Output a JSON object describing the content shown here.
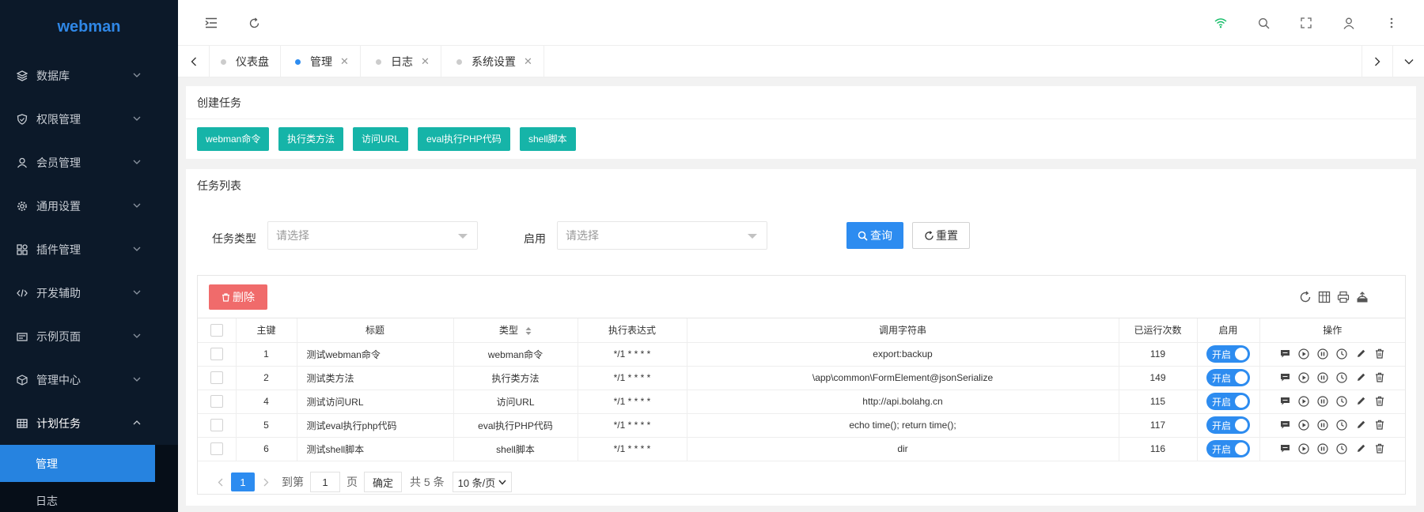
{
  "app": {
    "logo": "webman"
  },
  "sidebar": {
    "items": [
      {
        "label": "数据库",
        "icon": "database-icon"
      },
      {
        "label": "权限管理",
        "icon": "shield-icon"
      },
      {
        "label": "会员管理",
        "icon": "user-icon"
      },
      {
        "label": "通用设置",
        "icon": "gear-icon"
      },
      {
        "label": "插件管理",
        "icon": "plugin-icon"
      },
      {
        "label": "开发辅助",
        "icon": "code-icon"
      },
      {
        "label": "示例页面",
        "icon": "page-icon"
      },
      {
        "label": "管理中心",
        "icon": "box-icon"
      },
      {
        "label": "计划任务",
        "icon": "grid-icon"
      }
    ],
    "submenu": [
      {
        "label": "管理",
        "active": true
      },
      {
        "label": "日志",
        "active": false
      }
    ]
  },
  "tabs": [
    {
      "label": "仪表盘",
      "closable": false,
      "active": false
    },
    {
      "label": "管理",
      "closable": true,
      "active": true
    },
    {
      "label": "日志",
      "closable": true,
      "active": false
    },
    {
      "label": "系统设置",
      "closable": true,
      "active": false
    }
  ],
  "create_panel": {
    "title": "创建任务",
    "buttons": [
      "webman命令",
      "执行类方法",
      "访问URL",
      "eval执行PHP代码",
      "shell脚本"
    ]
  },
  "list_panel": {
    "title": "任务列表",
    "filters": {
      "type_label": "任务类型",
      "type_placeholder": "请选择",
      "enable_label": "启用",
      "enable_placeholder": "请选择",
      "query_label": "查询",
      "reset_label": "重置"
    },
    "delete_label": "删除",
    "columns": [
      "主键",
      "标题",
      "类型",
      "执行表达式",
      "调用字符串",
      "已运行次数",
      "启用",
      "操作"
    ],
    "rows": [
      {
        "id": "1",
        "title": "测试webman命令",
        "type": "webman命令",
        "expr": "*/1 * * * *",
        "target": "export:backup",
        "runs": "119",
        "enabled": "开启"
      },
      {
        "id": "2",
        "title": "测试类方法",
        "type": "执行类方法",
        "expr": "*/1 * * * *",
        "target": "\\app\\common\\FormElement@jsonSerialize",
        "runs": "149",
        "enabled": "开启"
      },
      {
        "id": "4",
        "title": "测试访问URL",
        "type": "访问URL",
        "expr": "*/1 * * * *",
        "target": "http://api.bolahg.cn",
        "runs": "115",
        "enabled": "开启"
      },
      {
        "id": "5",
        "title": "测试eval执行php代码",
        "type": "eval执行PHP代码",
        "expr": "*/1 * * * *",
        "target": "echo time(); return time();",
        "runs": "117",
        "enabled": "开启"
      },
      {
        "id": "6",
        "title": "测试shell脚本",
        "type": "shell脚本",
        "expr": "*/1 * * * *",
        "target": "dir",
        "runs": "116",
        "enabled": "开启"
      }
    ],
    "pager": {
      "current": "1",
      "goto_prefix": "到第",
      "goto_value": "1",
      "goto_suffix": "页",
      "confirm": "确定",
      "total": "共 5 条",
      "page_size": "10 条/页"
    }
  }
}
